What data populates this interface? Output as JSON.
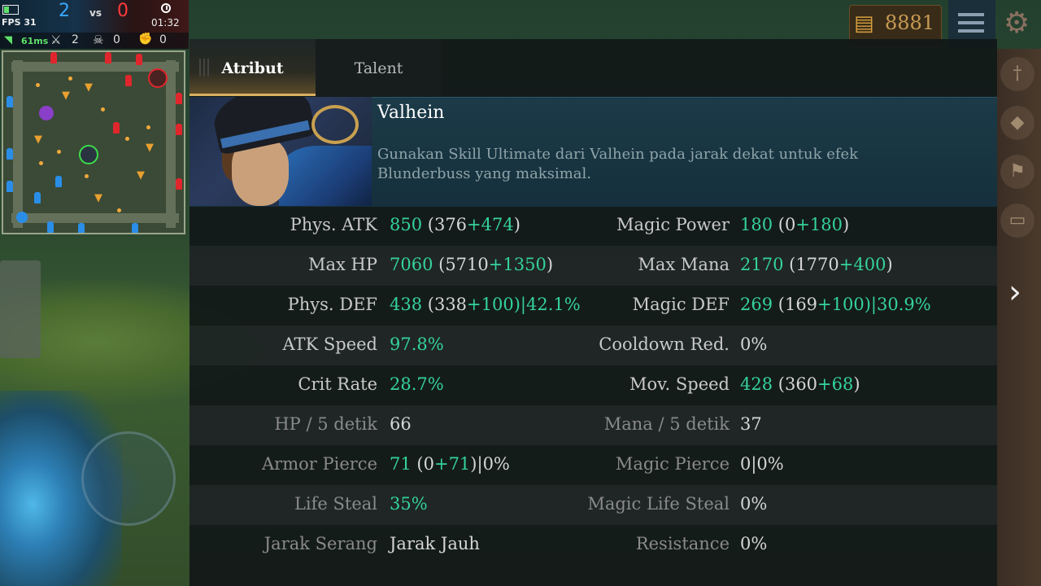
{
  "hud": {
    "fps": "FPS 31",
    "blue_score": "2",
    "vs": "vs",
    "red_score": "0",
    "time": "01:32",
    "ping": "61ms",
    "kills": "2",
    "deaths": "0",
    "assists": "0"
  },
  "shop": {
    "gold": "8881"
  },
  "tabs": [
    {
      "label": "Atribut",
      "active": true
    },
    {
      "label": "Talent",
      "active": false
    }
  ],
  "hero": {
    "name": "Valhein",
    "tip": "Gunakan Skill Ultimate dari Valhein pada jarak dekat untuk efek Blunderbuss yang maksimal."
  },
  "stats": [
    {
      "l_label": "Phys. ATK",
      "l_main": "850",
      "l_extra": " (376",
      "l_bonus": "+474",
      "l_tail": ")",
      "r_label": "Magic Power",
      "r_main": "180",
      "r_extra": " (0",
      "r_bonus": "+180",
      "r_tail": ")"
    },
    {
      "l_label": "Max HP",
      "l_main": "7060",
      "l_extra": " (5710",
      "l_bonus": "+1350",
      "l_tail": ")",
      "r_label": "Max Mana",
      "r_main": "2170",
      "r_extra": " (1770",
      "r_bonus": "+400",
      "r_tail": ")"
    },
    {
      "l_label": "Phys. DEF",
      "l_main": "438",
      "l_extra": " (338",
      "l_bonus": "+100",
      "l_tail": ")|42.1%",
      "r_label": "Magic DEF",
      "r_main": "269",
      "r_extra": " (169",
      "r_bonus": "+100",
      "r_tail": ")|30.9%"
    },
    {
      "l_label": "ATK Speed",
      "l_main": "97.8%",
      "r_label": "Cooldown Red.",
      "r_main": "0%"
    },
    {
      "l_label": "Crit Rate",
      "l_main": "28.7%",
      "r_label": "Mov. Speed",
      "r_main": "428",
      "r_extra": " (360",
      "r_bonus": "+68",
      "r_tail": ")"
    },
    {
      "l_label": "HP / 5 detik",
      "l_main": "66",
      "r_label": "Mana / 5 detik",
      "r_main": "37"
    },
    {
      "l_label": "Armor Pierce",
      "l_main": "71",
      "l_extra": " (0",
      "l_bonus": "+71",
      "l_tail": ")|0%",
      "r_label": "Magic Pierce",
      "r_main": "0|0%"
    },
    {
      "l_label": "Life Steal",
      "l_main": "35%",
      "r_label": "Magic Life Steal",
      "r_main": "0%"
    },
    {
      "l_label": "Jarak Serang",
      "l_main": "Jarak Jauh",
      "r_label": "Resistance",
      "r_main": "0%"
    }
  ],
  "colors": {
    "stat_green": "#35d29a",
    "blue_team": "#39a8ff",
    "red_team": "#ff3b3b",
    "tab_accent": "#d8b060"
  }
}
